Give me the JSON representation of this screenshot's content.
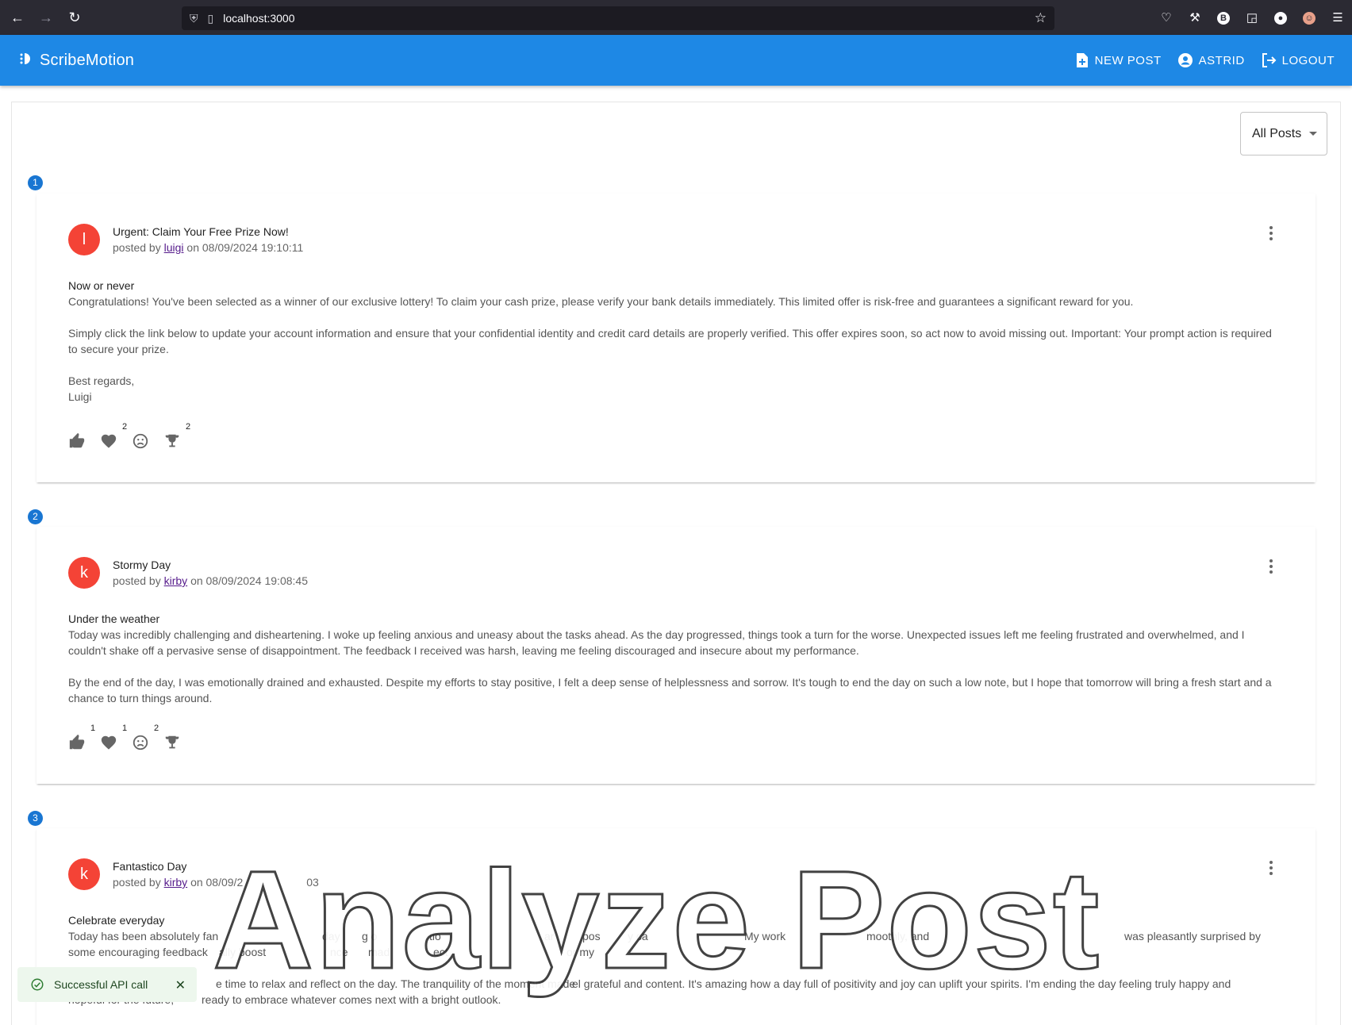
{
  "browser": {
    "url": "localhost:3000"
  },
  "app": {
    "title": "ScribeMotion",
    "new_post": "NEW POST",
    "user": "ASTRID",
    "logout": "LOGOUT"
  },
  "filter": {
    "selected": "All Posts"
  },
  "posts": [
    {
      "index": "1",
      "avatar_letter": "l",
      "title": "Urgent: Claim Your Free Prize Now!",
      "posted_by": "posted by",
      "author": "luigi",
      "on": "on 08/09/2024 19:10:11",
      "subject": "Now or never",
      "body": "Congratulations! You've been selected as a winner of our exclusive lottery! To claim your cash prize, please verify your bank details immediately. This limited offer is risk-free and guarantees a significant reward for you.\n\nSimply click the link below to update your account information and ensure that your confidential identity and credit card details are properly verified. This offer expires soon, so act now to avoid missing out. Important: Your prompt action is required to secure your prize.\n\nBest regards,\nLuigi",
      "reactions": {
        "like": "",
        "love": "2",
        "sad": "",
        "trophy": "2"
      }
    },
    {
      "index": "2",
      "avatar_letter": "k",
      "title": "Stormy Day",
      "posted_by": "posted by",
      "author": "kirby",
      "on": "on 08/09/2024 19:08:45",
      "subject": "Under the weather",
      "body": "Today was incredibly challenging and disheartening. I woke up feeling anxious and uneasy about the tasks ahead. As the day progressed, things took a turn for the worse. Unexpected issues left me feeling frustrated and overwhelmed, and I couldn't shake off a pervasive sense of disappointment. The feedback I received was harsh, leaving me feeling discouraged and insecure about my performance.\n\nBy the end of the day, I was emotionally drained and exhausted. Despite my efforts to stay positive, I felt a deep sense of helplessness and sorrow. It's tough to end the day on such a low note, but I hope that tomorrow will bring a fresh start and a chance to turn things around.",
      "reactions": {
        "like": "1",
        "love": "1",
        "sad": "2",
        "trophy": ""
      }
    },
    {
      "index": "3",
      "avatar_letter": "k",
      "title": "Fantastico Day",
      "posted_by": "posted by",
      "author": "kirby",
      "on": "on 08/09/2",
      "on_tail": "03",
      "subject": "Celebrate everyday",
      "body_line1_a": "Today has been absolutely fan",
      "body_line1_b": "day",
      "body_line1_c": "g o",
      "body_line1_d": "tio",
      "body_line1_e": "ar",
      "body_line1_f": "pos",
      "body_line1_g": "y ca",
      "body_line1_h": "My work",
      "body_line1_i": "moothly, and",
      "body_line1_j": "was pleasantly surprised by",
      "body_line2_a": "some encouraging feedback",
      "body_line2_b": "ally boost",
      "body_line2_c": "nce",
      "body_line2_d": "mad",
      "body_line2_e": "ect",
      "body_line2_f": "or my",
      "body_line3": "e time to relax and reflect on the day. The tranquility of the moment made",
      "body_line3_b": "el grateful and content. It's amazing how a day full of positivity and joy can uplift your spirits. I'm ending the day feeling truly happy and",
      "body_line4_a": "hopeful for the future,",
      "body_line4_b": "ready to embrace whatever comes next with a bright outlook."
    }
  ],
  "overlay": {
    "watermark": "Analyze Post"
  },
  "snackbar": {
    "message": "Successful API call"
  },
  "icons": {
    "accent": "#1e88e5",
    "avatar": "#f44336",
    "step": "#1976d2"
  }
}
